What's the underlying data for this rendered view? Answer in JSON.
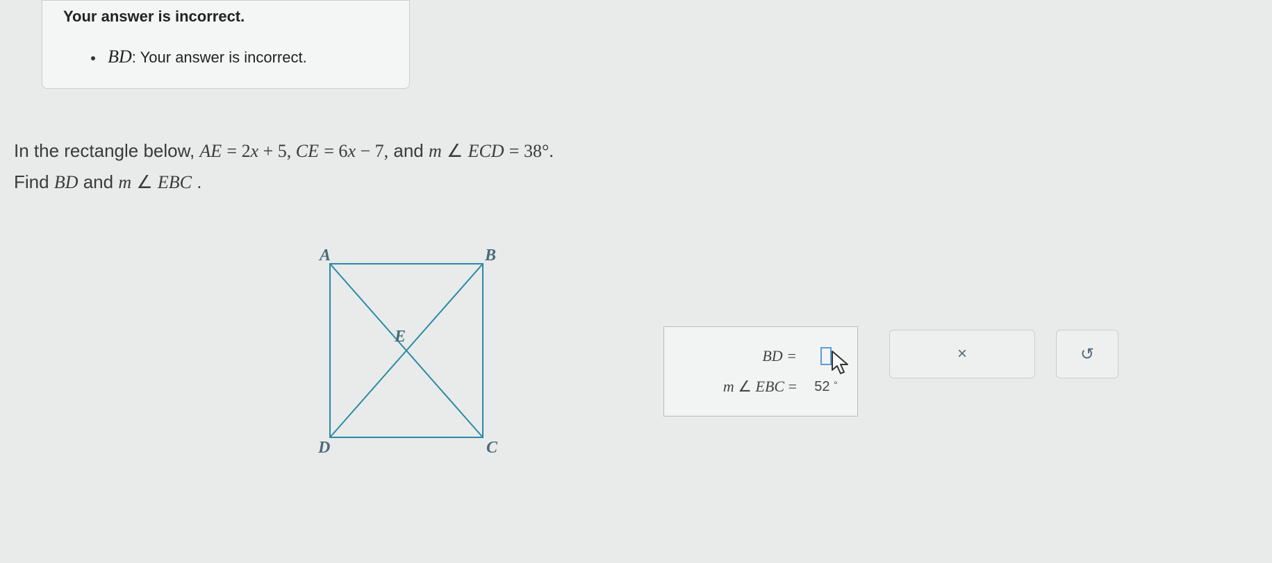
{
  "feedback": {
    "title": "Your answer is incorrect.",
    "item_var": "BD",
    "item_sep": ": ",
    "item_msg": "Your answer is incorrect."
  },
  "problem": {
    "line1_a": "In the rectangle below, ",
    "ae": "AE",
    "eq1": " = 2x + 5, ",
    "ce": "CE",
    "eq2": " = 6x − 7,",
    "line1_b": " and ",
    "m1": "m",
    "ang1": "∠",
    "ecd": "ECD",
    "eq3": " = 38°.",
    "line2_a": "Find ",
    "bd": "BD",
    "line2_b": " and ",
    "m2": "m",
    "ang2": "∠",
    "ebc": "EBC",
    "line2_c": "."
  },
  "diagram": {
    "A": "A",
    "B": "B",
    "C": "C",
    "D": "D",
    "E": "E"
  },
  "answers": {
    "bd_label": "BD  =",
    "bd_value": "",
    "ebc_label_m": "m",
    "ebc_label_ang": "∠",
    "ebc_label_name": "EBC",
    "ebc_label_eq": "  =",
    "ebc_value": "52",
    "ebc_unit": "°"
  },
  "buttons": {
    "reset": "×",
    "redo": "↺"
  }
}
